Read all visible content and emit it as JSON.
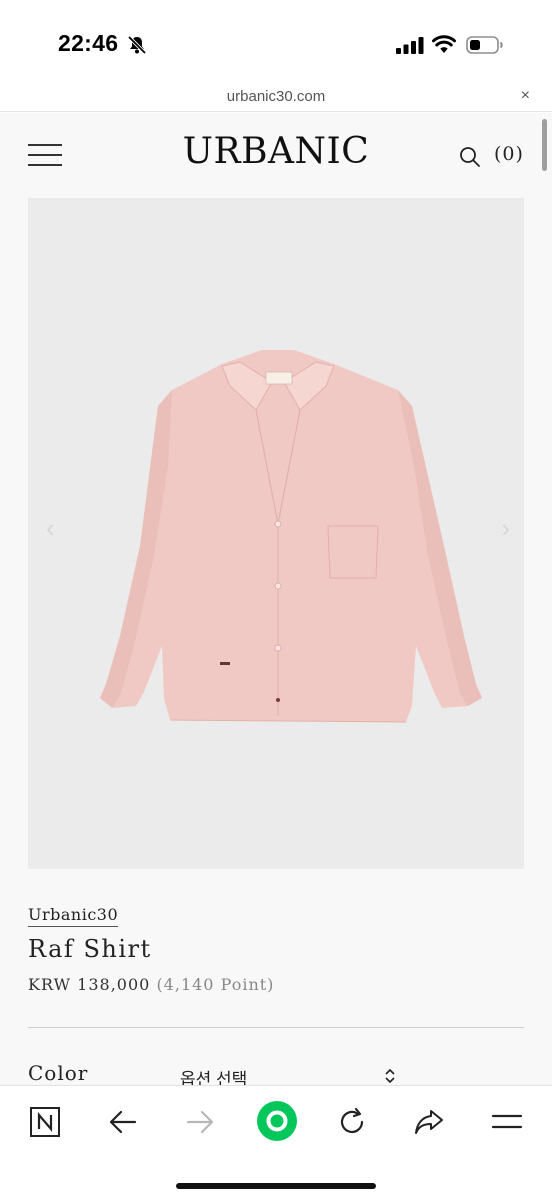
{
  "status_bar": {
    "time": "22:46",
    "icons": [
      "bell-slash-icon",
      "signal-icon",
      "wifi-icon",
      "battery-icon"
    ]
  },
  "browser": {
    "url": "urbanic30.com",
    "close_glyph": "×"
  },
  "header": {
    "logo": "URBANIC",
    "cart_count": "(0)",
    "icons": [
      "menu-icon",
      "search-icon"
    ]
  },
  "product": {
    "brand": "Urbanic30",
    "title": "Raf Shirt",
    "price": "KRW 138,000",
    "points": "(4,140 Point)",
    "color_label": "Color",
    "option_placeholder": "옵션 선택",
    "image_colors": {
      "background": "#ebebeb",
      "shirt": "#f1c9c4"
    }
  },
  "toolbar": {
    "icons": [
      "naver-icon",
      "back-arrow-icon",
      "forward-arrow-icon",
      "green-dot-icon",
      "reload-icon",
      "share-icon",
      "menu-lines-icon"
    ],
    "accent_color": "#03c75a"
  }
}
